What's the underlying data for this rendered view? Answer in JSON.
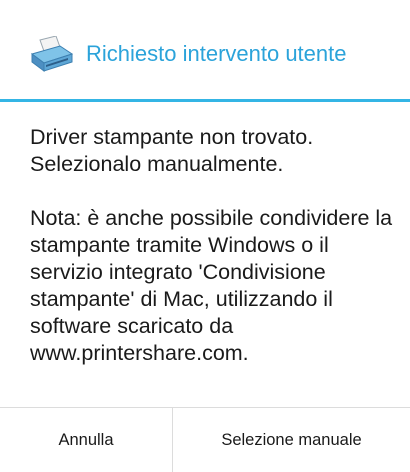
{
  "dialog": {
    "title": "Richiesto intervento utente",
    "icon": "printer-icon",
    "accent_color": "#34b5e5",
    "title_color": "#2ba3da",
    "message_line1": "Driver stampante non trovato. Selezionalo manualmente.",
    "message_line2": "Nota: è anche possibile condividere la stampante tramite Windows o il servizio integrato 'Condivisione stampante' di Mac, utilizzando il software scaricato da www.printershare.com."
  },
  "buttons": {
    "cancel_label": "Annulla",
    "manual_label": "Selezione manuale"
  }
}
